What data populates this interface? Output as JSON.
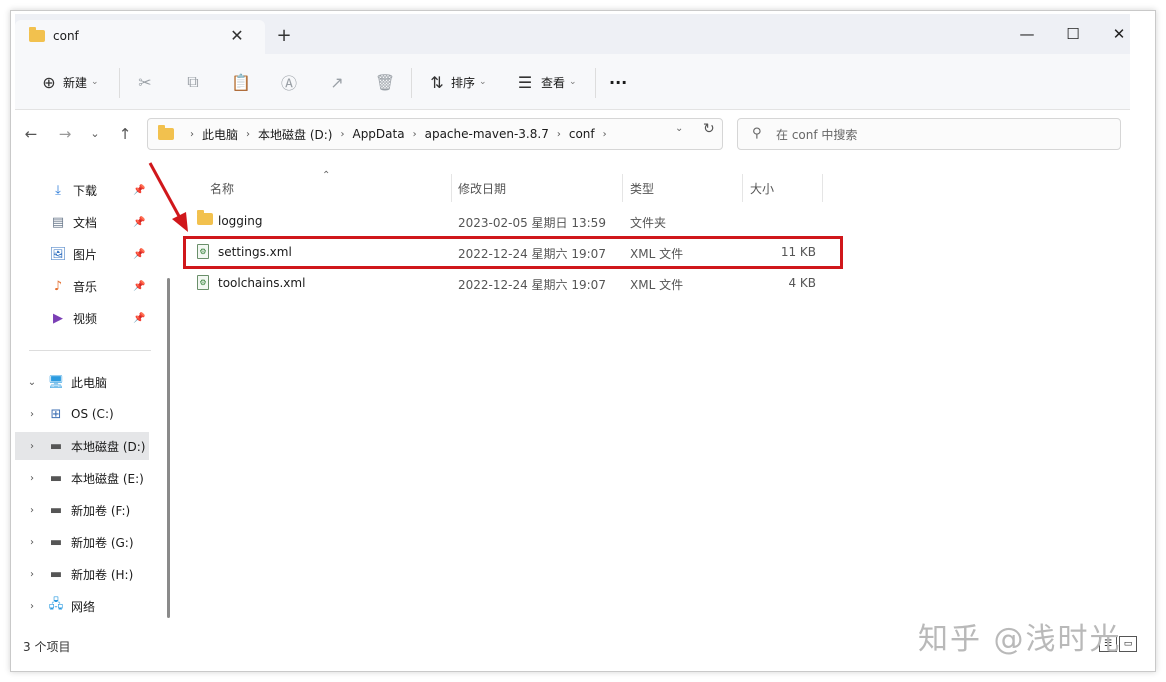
{
  "tab": {
    "title": "conf",
    "close": "✕",
    "new": "+"
  },
  "window_controls": {
    "minimize": "—",
    "maximize": "☐",
    "close": "✕"
  },
  "toolbar": {
    "new_label": "新建",
    "sort_label": "排序",
    "view_label": "查看",
    "more_label": "···"
  },
  "nav": {
    "breadcrumb": [
      "此电脑",
      "本地磁盘 (D:)",
      "AppData",
      "apache-maven-3.8.7",
      "conf"
    ],
    "search_placeholder": "在 conf 中搜索"
  },
  "sidebar": {
    "quick_access": [
      {
        "label": "下载",
        "icon": "download-icon"
      },
      {
        "label": "文档",
        "icon": "document-icon"
      },
      {
        "label": "图片",
        "icon": "picture-icon"
      },
      {
        "label": "音乐",
        "icon": "music-icon"
      },
      {
        "label": "视频",
        "icon": "video-icon"
      }
    ],
    "this_pc": "此电脑",
    "drives": [
      {
        "label": "OS (C:)"
      },
      {
        "label": "本地磁盘 (D:)",
        "selected": true
      },
      {
        "label": "本地磁盘 (E:)"
      },
      {
        "label": "新加卷 (F:)"
      },
      {
        "label": "新加卷 (G:)"
      },
      {
        "label": "新加卷 (H:)"
      }
    ],
    "network": "网络"
  },
  "columns": {
    "name": "名称",
    "modified": "修改日期",
    "type": "类型",
    "size": "大小"
  },
  "files": [
    {
      "name": "logging",
      "modified": "2023-02-05 星期日 13:59",
      "type": "文件夹",
      "size": "",
      "kind": "folder"
    },
    {
      "name": "settings.xml",
      "modified": "2022-12-24 星期六 19:07",
      "type": "XML 文件",
      "size": "11 KB",
      "kind": "xml",
      "highlighted": true
    },
    {
      "name": "toolchains.xml",
      "modified": "2022-12-24 星期六 19:07",
      "type": "XML 文件",
      "size": "4 KB",
      "kind": "xml"
    }
  ],
  "status": {
    "count": "3 个项目"
  },
  "watermark": "知乎 @浅时光",
  "colors": {
    "highlight": "#d0171b",
    "folder": "#f2c14e",
    "selected_bg": "#e5e6e8"
  }
}
